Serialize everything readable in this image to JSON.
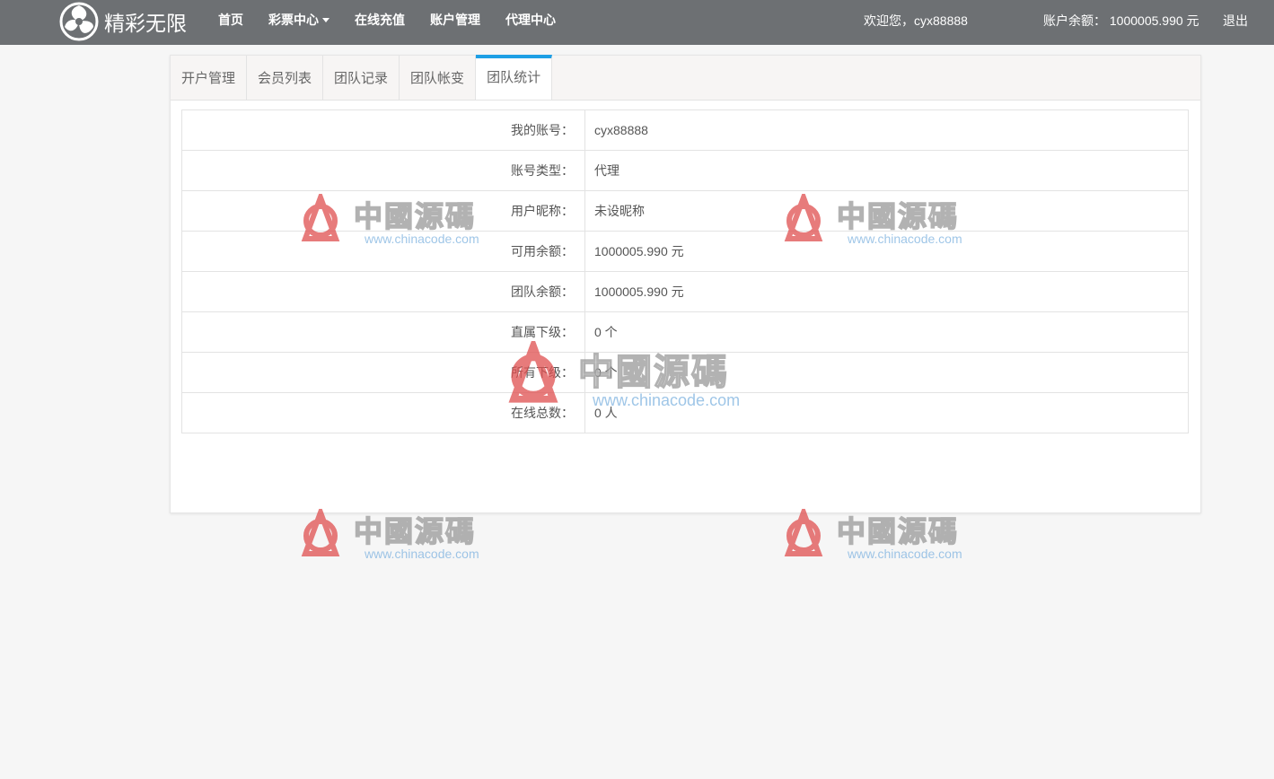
{
  "header": {
    "logo_text": "精彩无限",
    "nav": [
      {
        "label": "首页"
      },
      {
        "label": "彩票中心"
      },
      {
        "label": "在线充值"
      },
      {
        "label": "账户管理"
      },
      {
        "label": "代理中心"
      }
    ],
    "welcome": "欢迎您，cyx88888",
    "balance": "账户余额： 1000005.990 元",
    "logout": "退出"
  },
  "tabs": [
    {
      "label": "开户管理"
    },
    {
      "label": "会员列表"
    },
    {
      "label": "团队记录"
    },
    {
      "label": "团队帐变"
    },
    {
      "label": "团队统计",
      "active": true
    }
  ],
  "rows": [
    {
      "label": "我的账号：",
      "value": "cyx88888"
    },
    {
      "label": "账号类型：",
      "value": "代理"
    },
    {
      "label": "用户昵称：",
      "value": "未设昵称"
    },
    {
      "label": "可用余额：",
      "value": "1000005.990 元"
    },
    {
      "label": "团队余额：",
      "value": "1000005.990 元"
    },
    {
      "label": "直属下级：",
      "value": "0 个"
    },
    {
      "label": "所有下级：",
      "value": "0 个"
    },
    {
      "label": "在线总数：",
      "value": "0 人"
    }
  ],
  "watermark": {
    "text": "中國源碼",
    "url": "www.chinacode.com"
  },
  "colors": {
    "topbar": "#6d7073",
    "active_tab_accent": "#1e9fe5",
    "watermark_red": "#e05050"
  }
}
